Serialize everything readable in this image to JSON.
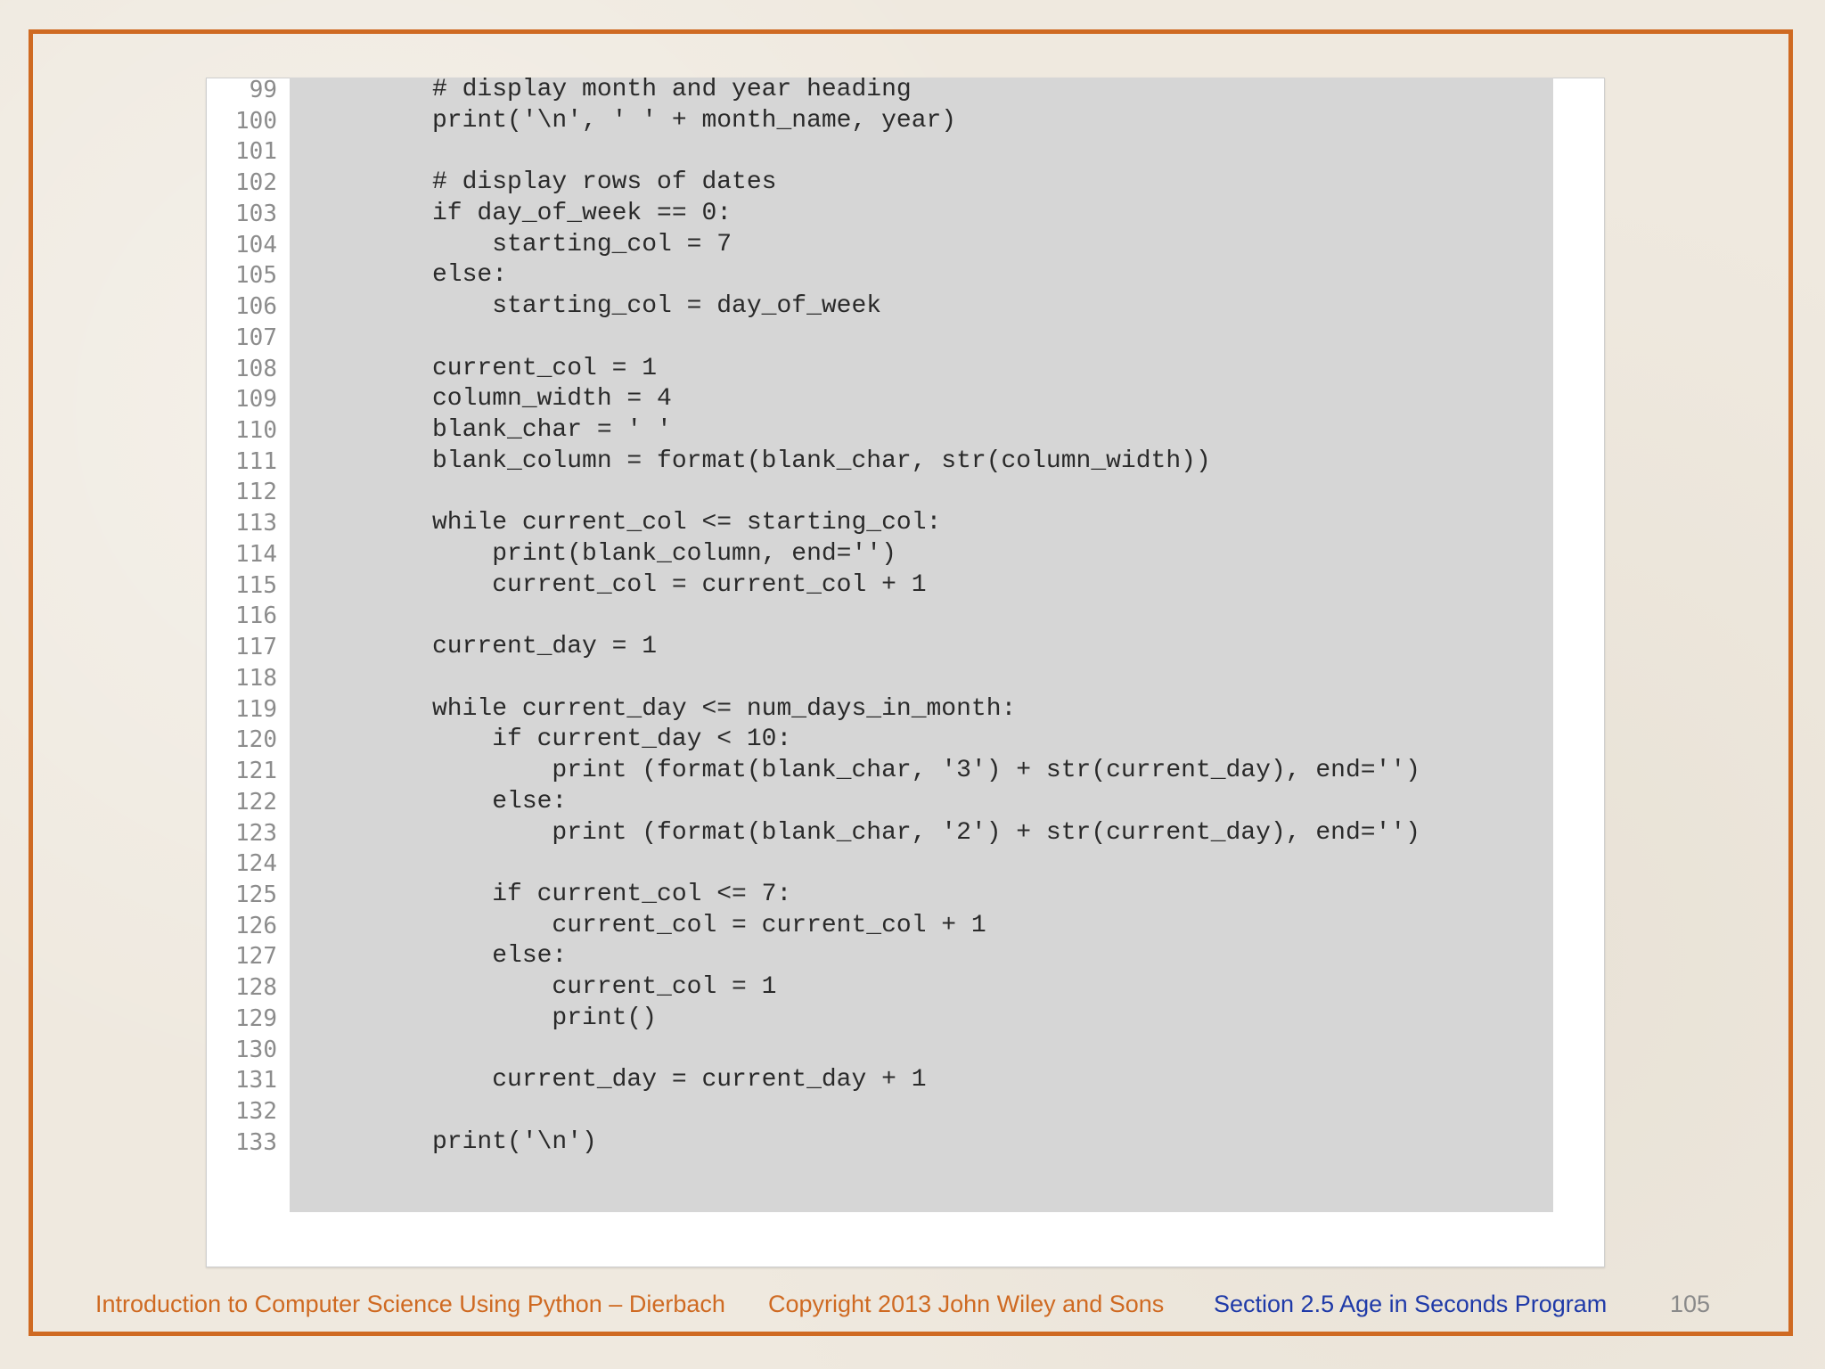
{
  "code": {
    "lines": [
      {
        "num": "99",
        "text": "# display month and year heading"
      },
      {
        "num": "100",
        "text": "print('\\n', ' ' + month_name, year)"
      },
      {
        "num": "101",
        "text": ""
      },
      {
        "num": "102",
        "text": "# display rows of dates"
      },
      {
        "num": "103",
        "text": "if day_of_week == 0:"
      },
      {
        "num": "104",
        "text": "    starting_col = 7"
      },
      {
        "num": "105",
        "text": "else:"
      },
      {
        "num": "106",
        "text": "    starting_col = day_of_week"
      },
      {
        "num": "107",
        "text": ""
      },
      {
        "num": "108",
        "text": "current_col = 1"
      },
      {
        "num": "109",
        "text": "column_width = 4"
      },
      {
        "num": "110",
        "text": "blank_char = ' '"
      },
      {
        "num": "111",
        "text": "blank_column = format(blank_char, str(column_width))"
      },
      {
        "num": "112",
        "text": ""
      },
      {
        "num": "113",
        "text": "while current_col <= starting_col:"
      },
      {
        "num": "114",
        "text": "    print(blank_column, end='')"
      },
      {
        "num": "115",
        "text": "    current_col = current_col + 1"
      },
      {
        "num": "116",
        "text": ""
      },
      {
        "num": "117",
        "text": "current_day = 1"
      },
      {
        "num": "118",
        "text": ""
      },
      {
        "num": "119",
        "text": "while current_day <= num_days_in_month:"
      },
      {
        "num": "120",
        "text": "    if current_day < 10:"
      },
      {
        "num": "121",
        "text": "        print (format(blank_char, '3') + str(current_day), end='')"
      },
      {
        "num": "122",
        "text": "    else:"
      },
      {
        "num": "123",
        "text": "        print (format(blank_char, '2') + str(current_day), end='')"
      },
      {
        "num": "124",
        "text": ""
      },
      {
        "num": "125",
        "text": "    if current_col <= 7:"
      },
      {
        "num": "126",
        "text": "        current_col = current_col + 1"
      },
      {
        "num": "127",
        "text": "    else:"
      },
      {
        "num": "128",
        "text": "        current_col = 1"
      },
      {
        "num": "129",
        "text": "        print()"
      },
      {
        "num": "130",
        "text": ""
      },
      {
        "num": "131",
        "text": "    current_day = current_day + 1"
      },
      {
        "num": "132",
        "text": ""
      },
      {
        "num": "133",
        "text": "print('\\n')"
      }
    ]
  },
  "footer": {
    "book": "Introduction to Computer Science Using Python – Dierbach",
    "copyright": "Copyright 2013 John Wiley and  Sons",
    "section": "Section 2.5  Age in Seconds Program",
    "page": "105"
  },
  "colors": {
    "accent": "#cf6a22",
    "section_blue": "#1f3aa8",
    "code_bg": "#d6d6d6",
    "background": "#efe9df"
  }
}
